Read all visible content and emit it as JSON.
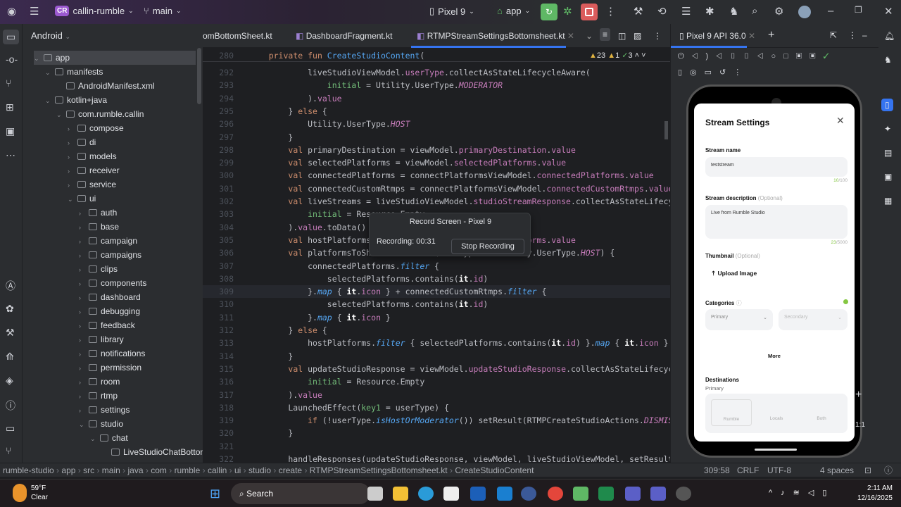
{
  "topbar": {
    "project_badge": "CR",
    "project": "callin-rumble",
    "branch": "main",
    "device": "Pixel 9",
    "run_config": "app"
  },
  "project_panel": {
    "view": "Android",
    "tree": [
      {
        "label": "app",
        "level": 0,
        "open": true
      },
      {
        "label": "manifests",
        "level": 1,
        "open": true
      },
      {
        "label": "AndroidManifest.xml",
        "level": 2,
        "leaf": true
      },
      {
        "label": "kotlin+java",
        "level": 1,
        "open": true
      },
      {
        "label": "com.rumble.callin",
        "level": 2,
        "open": true
      },
      {
        "label": "compose",
        "level": 3
      },
      {
        "label": "di",
        "level": 3
      },
      {
        "label": "models",
        "level": 3
      },
      {
        "label": "receiver",
        "level": 3
      },
      {
        "label": "service",
        "level": 3
      },
      {
        "label": "ui",
        "level": 3,
        "open": true
      },
      {
        "label": "auth",
        "level": 4
      },
      {
        "label": "base",
        "level": 4
      },
      {
        "label": "campaign",
        "level": 4
      },
      {
        "label": "campaigns",
        "level": 4
      },
      {
        "label": "clips",
        "level": 4
      },
      {
        "label": "components",
        "level": 4
      },
      {
        "label": "dashboard",
        "level": 4
      },
      {
        "label": "debugging",
        "level": 4
      },
      {
        "label": "feedback",
        "level": 4
      },
      {
        "label": "library",
        "level": 4
      },
      {
        "label": "notifications",
        "level": 4
      },
      {
        "label": "permission",
        "level": 4
      },
      {
        "label": "room",
        "level": 4
      },
      {
        "label": "rtmp",
        "level": 4
      },
      {
        "label": "settings",
        "level": 4
      },
      {
        "label": "studio",
        "level": 4,
        "open": true
      },
      {
        "label": "chat",
        "level": 5,
        "open": true
      },
      {
        "label": "LiveStudioChatBottom",
        "level": 6,
        "leaf": true
      }
    ]
  },
  "editor": {
    "tabs": [
      "omBottomSheet.kt",
      "DashboardFragment.kt",
      "RTMPStreamSettingsBottomsheet.kt"
    ],
    "active_tab": 2,
    "inspections": {
      "warnings": "23",
      "weak": "1",
      "ok": "3"
    },
    "lines": [
      {
        "n": "280",
        "t": [
          [
            "    ",
            "d"
          ],
          [
            "private fun ",
            "k"
          ],
          [
            "CreateStudioContent",
            "f"
          ],
          [
            "(",
            "d"
          ]
        ]
      },
      {
        "n": "292",
        "t": [
          [
            "            liveStudioViewModel.",
            "d"
          ],
          [
            "userType",
            "p"
          ],
          [
            ".collectAsStateLifecycleAware(",
            "d"
          ]
        ]
      },
      {
        "n": "293",
        "t": [
          [
            "                initial",
            "g"
          ],
          [
            " = Utility.UserType.",
            "d"
          ],
          [
            "MODERATOR",
            "c"
          ]
        ]
      },
      {
        "n": "294",
        "t": [
          [
            "            ).",
            "d"
          ],
          [
            "value",
            "p"
          ]
        ]
      },
      {
        "n": "295",
        "t": [
          [
            "        } ",
            "d"
          ],
          [
            "else",
            "k"
          ],
          [
            " {",
            "d"
          ]
        ]
      },
      {
        "n": "296",
        "t": [
          [
            "            Utility.UserType.",
            "d"
          ],
          [
            "HOST",
            "c"
          ]
        ]
      },
      {
        "n": "297",
        "t": [
          [
            "        }",
            "d"
          ]
        ]
      },
      {
        "n": "298",
        "t": [
          [
            "        ",
            "d"
          ],
          [
            "val ",
            "k"
          ],
          [
            "primaryDestination = viewModel.",
            "d"
          ],
          [
            "primaryDestination",
            "p"
          ],
          [
            ".",
            "d"
          ],
          [
            "value",
            "p"
          ]
        ]
      },
      {
        "n": "299",
        "t": [
          [
            "        ",
            "d"
          ],
          [
            "val ",
            "k"
          ],
          [
            "selectedPlatforms = viewModel.",
            "d"
          ],
          [
            "selectedPlatforms",
            "p"
          ],
          [
            ".",
            "d"
          ],
          [
            "value",
            "p"
          ]
        ]
      },
      {
        "n": "300",
        "t": [
          [
            "        ",
            "d"
          ],
          [
            "val ",
            "k"
          ],
          [
            "connectedPlatforms = connectPlatformsViewModel.",
            "d"
          ],
          [
            "connectedPlatforms",
            "p"
          ],
          [
            ".",
            "d"
          ],
          [
            "value",
            "p"
          ]
        ]
      },
      {
        "n": "301",
        "t": [
          [
            "        ",
            "d"
          ],
          [
            "val ",
            "k"
          ],
          [
            "connectedCustomRtmps = connectPlatformsViewModel.",
            "d"
          ],
          [
            "connectedCustomRtmps",
            "p"
          ],
          [
            ".",
            "d"
          ],
          [
            "value",
            "p"
          ]
        ]
      },
      {
        "n": "302",
        "t": [
          [
            "        ",
            "d"
          ],
          [
            "val ",
            "k"
          ],
          [
            "liveStreams = liveStudioViewModel.",
            "d"
          ],
          [
            "studioStreamResponse",
            "p"
          ],
          [
            ".collectAsStateLifecycleAwa",
            "d"
          ]
        ]
      },
      {
        "n": "303",
        "t": [
          [
            "            initial",
            "g"
          ],
          [
            " = Resource.Empty",
            "d"
          ]
        ]
      },
      {
        "n": "304",
        "t": [
          [
            "        ).",
            "d"
          ],
          [
            "value",
            "p"
          ],
          [
            ".toData()",
            "d"
          ]
        ]
      },
      {
        "n": "305",
        "t": [
          [
            "        ",
            "d"
          ],
          [
            "val ",
            "k"
          ],
          [
            "hostPlatforms = liveStudioViewModel.",
            "d"
          ],
          [
            "hostPlatforms",
            "p"
          ],
          [
            ".",
            "d"
          ],
          [
            "value",
            "p"
          ]
        ]
      },
      {
        "n": "306",
        "t": [
          [
            "        ",
            "d"
          ],
          [
            "val ",
            "k"
          ],
          [
            "platformsToShowIcons = if (userType == Utility.UserType.",
            "d"
          ],
          [
            "HOST",
            "c"
          ],
          [
            ") {",
            "d"
          ]
        ]
      },
      {
        "n": "307",
        "t": [
          [
            "            connectedPlatforms.",
            "d"
          ],
          [
            "filter",
            "it"
          ],
          [
            " {",
            "d"
          ]
        ]
      },
      {
        "n": "308",
        "t": [
          [
            "                selectedPlatforms.contains(",
            "d"
          ],
          [
            "it",
            "b"
          ],
          [
            ".",
            "d"
          ],
          [
            "id",
            "p"
          ],
          [
            ")",
            "d"
          ]
        ]
      },
      {
        "n": "309",
        "t": [
          [
            "            }.",
            "d"
          ],
          [
            "map",
            "it"
          ],
          [
            " { ",
            "d"
          ],
          [
            "it",
            "b"
          ],
          [
            ".",
            "d"
          ],
          [
            "icon",
            "p"
          ],
          [
            " } + connectedCustomRtmps.",
            "d"
          ],
          [
            "filter",
            "it"
          ],
          [
            " {",
            "d"
          ]
        ]
      },
      {
        "n": "310",
        "t": [
          [
            "                selectedPlatforms.contains(",
            "d"
          ],
          [
            "it",
            "b"
          ],
          [
            ".",
            "d"
          ],
          [
            "id",
            "p"
          ],
          [
            ")",
            "d"
          ]
        ]
      },
      {
        "n": "311",
        "t": [
          [
            "            }.",
            "d"
          ],
          [
            "map",
            "it"
          ],
          [
            " { ",
            "d"
          ],
          [
            "it",
            "b"
          ],
          [
            ".",
            "d"
          ],
          [
            "icon",
            "p"
          ],
          [
            " }",
            "d"
          ]
        ]
      },
      {
        "n": "312",
        "t": [
          [
            "        } ",
            "d"
          ],
          [
            "else",
            "k"
          ],
          [
            " {",
            "d"
          ]
        ]
      },
      {
        "n": "313",
        "t": [
          [
            "            hostPlatforms.",
            "d"
          ],
          [
            "filter",
            "it"
          ],
          [
            " { selectedPlatforms.contains(",
            "d"
          ],
          [
            "it",
            "b"
          ],
          [
            ".",
            "d"
          ],
          [
            "id",
            "p"
          ],
          [
            ") }.",
            "d"
          ],
          [
            "map",
            "it"
          ],
          [
            " { ",
            "d"
          ],
          [
            "it",
            "b"
          ],
          [
            ".",
            "d"
          ],
          [
            "icon",
            "p"
          ],
          [
            " }",
            "d"
          ]
        ]
      },
      {
        "n": "314",
        "t": [
          [
            "        }",
            "d"
          ]
        ]
      },
      {
        "n": "315",
        "t": [
          [
            "        ",
            "d"
          ],
          [
            "val ",
            "k"
          ],
          [
            "updateStudioResponse = viewModel.",
            "d"
          ],
          [
            "updateStudioResponse",
            "p"
          ],
          [
            ".collectAsStateLifecycleAware",
            "d"
          ]
        ]
      },
      {
        "n": "316",
        "t": [
          [
            "            initial",
            "g"
          ],
          [
            " = Resource.Empty",
            "d"
          ]
        ]
      },
      {
        "n": "317",
        "t": [
          [
            "        ).",
            "d"
          ],
          [
            "value",
            "p"
          ]
        ]
      },
      {
        "n": "318",
        "t": [
          [
            "        LaunchedEffect(",
            "d"
          ],
          [
            "key1",
            "g"
          ],
          [
            " = userType) {",
            "d"
          ]
        ]
      },
      {
        "n": "319",
        "t": [
          [
            "            ",
            "d"
          ],
          [
            "if ",
            "k"
          ],
          [
            "(!userType.",
            "d"
          ],
          [
            "isHostOrModerator",
            "it"
          ],
          [
            "()) setResult(RTMPCreateStudioActions.",
            "d"
          ],
          [
            "DISMISS",
            "c"
          ],
          [
            ", nul",
            "d"
          ]
        ]
      },
      {
        "n": "320",
        "t": [
          [
            "        }",
            "d"
          ]
        ]
      },
      {
        "n": "321",
        "t": [
          [
            "",
            "d"
          ]
        ]
      },
      {
        "n": "322",
        "t": [
          [
            "        handleResponses(updateStudioResponse, viewModel, liveStudioViewModel, setResult)",
            "d"
          ]
        ]
      }
    ]
  },
  "record_popup": {
    "title": "Record Screen - Pixel 9",
    "recording": "Recording: 00:31",
    "stop_button": "Stop Recording"
  },
  "emulator": {
    "tab": "Pixel 9 API 36.0",
    "app": {
      "title": "Stream Settings",
      "stream_name_label": "Stream name",
      "stream_name_value": "teststream",
      "stream_name_count": "10",
      "stream_name_max": "/100",
      "desc_label": "Stream description",
      "optional": "(Optional)",
      "desc_value": "Live from Rumble Studio",
      "desc_count": "23",
      "desc_max": "/5000",
      "thumb_label": "Thumbnail",
      "upload": "Upload Image",
      "categories_label": "Categories",
      "primary_placeholder": "Primary",
      "secondary_placeholder": "Secondary",
      "more": "More",
      "destinations_label": "Destinations",
      "destinations_sub": "Primary",
      "dest_options": [
        "Rumble",
        "Locals",
        "Both"
      ]
    }
  },
  "emu_zoom": "1:1",
  "statusbar": {
    "breadcrumb": [
      "rumble-studio",
      "app",
      "src",
      "main",
      "java",
      "com",
      "rumble",
      "callin",
      "ui",
      "studio",
      "create",
      "RTMPStreamSettingsBottomsheet.kt",
      "CreateStudioContent"
    ],
    "position": "309:58",
    "line_sep": "CRLF",
    "encoding": "UTF-8",
    "indent": "4 spaces"
  },
  "taskbar": {
    "weather_temp": "59°F",
    "weather_cond": "Clear",
    "search": "Search",
    "time": "2:11 AM",
    "date": "12/16/2025"
  },
  "colors": {
    "accent": "#3574f0",
    "run": "#5fb865",
    "stop": "#db5c5c",
    "rumble_green": "#85c742"
  }
}
